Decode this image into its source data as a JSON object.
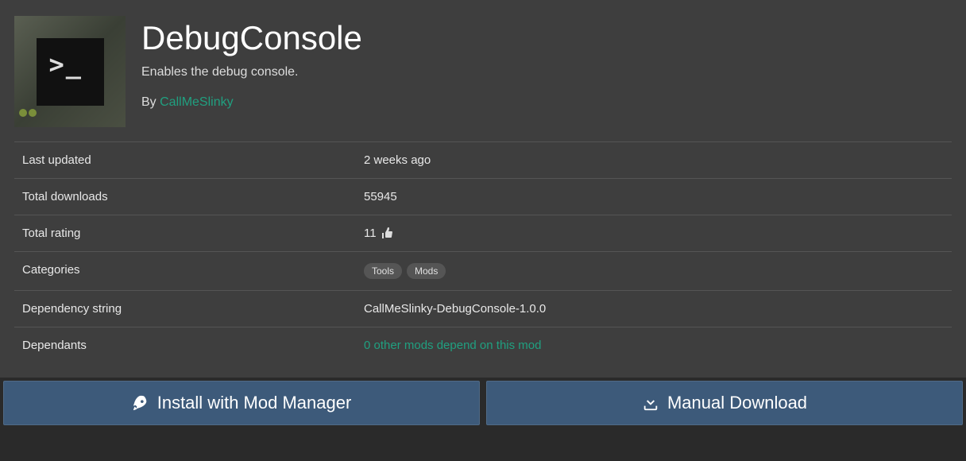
{
  "mod": {
    "title": "DebugConsole",
    "description": "Enables the debug console.",
    "by_label": "By ",
    "author": "CallMeSlinky"
  },
  "details": {
    "last_updated": {
      "label": "Last updated",
      "value": "2 weeks ago"
    },
    "total_downloads": {
      "label": "Total downloads",
      "value": "55945"
    },
    "total_rating": {
      "label": "Total rating",
      "value": "11"
    },
    "categories": {
      "label": "Categories",
      "items": [
        "Tools",
        "Mods"
      ]
    },
    "dependency_string": {
      "label": "Dependency string",
      "value": "CallMeSlinky-DebugConsole-1.0.0"
    },
    "dependants": {
      "label": "Dependants",
      "value": "0 other mods depend on this mod"
    }
  },
  "buttons": {
    "install": "Install with Mod Manager",
    "manual": "Manual Download"
  }
}
